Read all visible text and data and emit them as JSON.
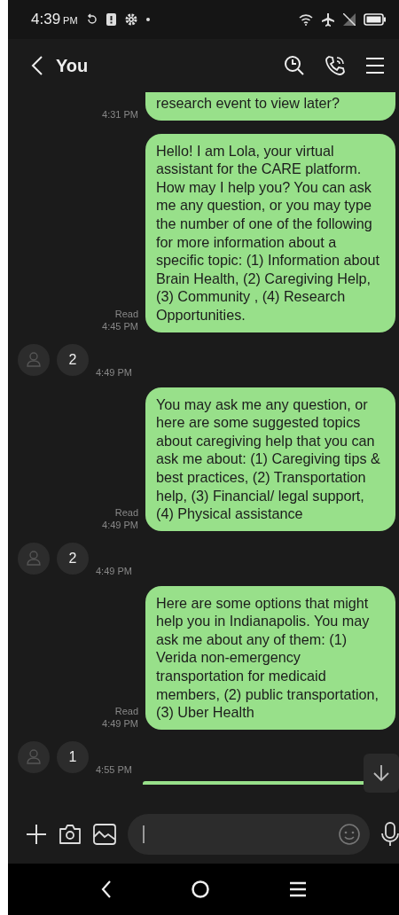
{
  "status_bar": {
    "time": "4:39",
    "period": "PM"
  },
  "header": {
    "title": "You"
  },
  "messages": [
    {
      "kind": "outgoing",
      "time": "4:31 PM",
      "text": "research event to view later?"
    },
    {
      "kind": "outgoing",
      "status": "Read",
      "time": "4:45 PM",
      "text": "Hello! I am Lola, your virtual assistant for the CARE platform. How may I help you? You can ask me any question, or you may type the number of one of the following for more information about a specific topic: (1) Information about Brain Health, (2) Caregiving Help, (3) Community , (4) Research Opportunities."
    },
    {
      "kind": "incoming",
      "time": "4:49 PM",
      "text": "2"
    },
    {
      "kind": "outgoing",
      "status": "Read",
      "time": "4:49 PM",
      "text": "You may ask me any question, or here are some suggested topics about caregiving help that you can ask me about: (1) Caregiving tips & best practices, (2) Transportation help, (3) Financial/ legal support, (4) Physical assistance"
    },
    {
      "kind": "incoming",
      "time": "4:49 PM",
      "text": "2"
    },
    {
      "kind": "outgoing",
      "status": "Read",
      "time": "4:49 PM",
      "text": "Here are some options that might help you in Indianapolis. You may ask me about any of them: (1) Verida non-emergency transportation for medicaid members, (2) public transportation, (3) Uber Health"
    },
    {
      "kind": "incoming",
      "time": "4:55 PM",
      "text": "1"
    }
  ]
}
